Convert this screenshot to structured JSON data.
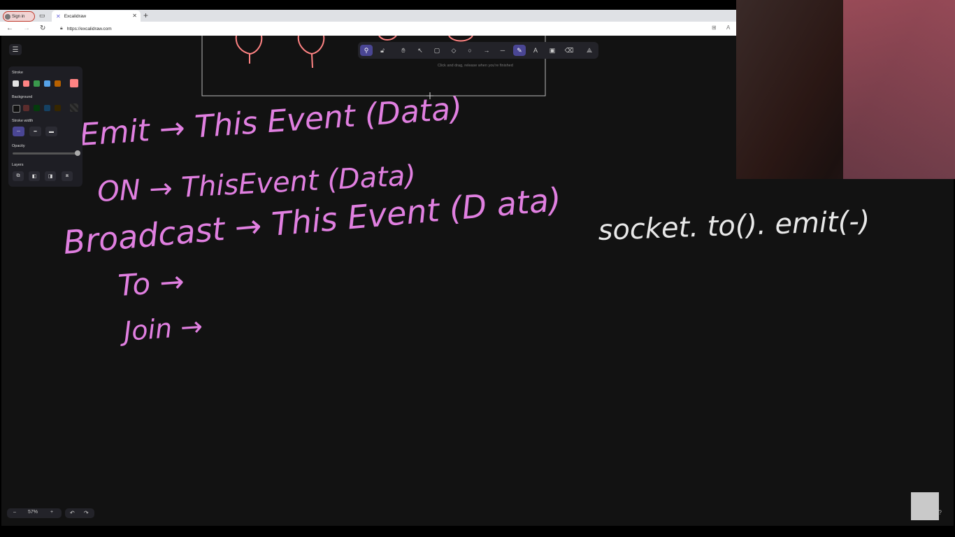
{
  "browser": {
    "signin_label": "Sign in",
    "tab_title": "Excalidraw",
    "url": "https://excalidraw.com"
  },
  "sidebar": {
    "stroke_label": "Stroke",
    "background_label": "Background",
    "stroke_width_label": "Stroke width",
    "opacity_label": "Opacity",
    "layers_label": "Layers",
    "stroke_colors": [
      "#e3e3e3",
      "#ff8383",
      "#3a994c",
      "#56a2e8",
      "#b76100"
    ],
    "stroke_selected": "#ff8383",
    "background_colors": [
      "#121212",
      "#5b2c2c",
      "#043b0c",
      "#154163",
      "#362600"
    ],
    "opacity_value": 100
  },
  "toolbar": {
    "tools": [
      "lock-icon",
      "hand-icon",
      "select-icon",
      "rectangle-icon",
      "diamond-icon",
      "ellipse-icon",
      "arrow-icon",
      "line-icon",
      "pencil-icon",
      "text-icon",
      "image-icon",
      "eraser-icon",
      "library-icon"
    ],
    "active_tool": "pencil-icon",
    "hint": "Click and drag, release when you're finished"
  },
  "footer": {
    "zoom_minus": "–",
    "zoom_level": "57%",
    "zoom_plus": "+"
  },
  "canvas": {
    "stroke_pink": "#e07fe0",
    "stroke_white": "#e8e8e8",
    "stroke_red": "#ff8383",
    "handwriting": [
      "Emit → This Event (Data)",
      "ON → ThisEvent (Data)",
      "Broadcast → This Event (D ata)",
      "To →",
      "Join →",
      "socket. to(). emit(-)"
    ]
  }
}
